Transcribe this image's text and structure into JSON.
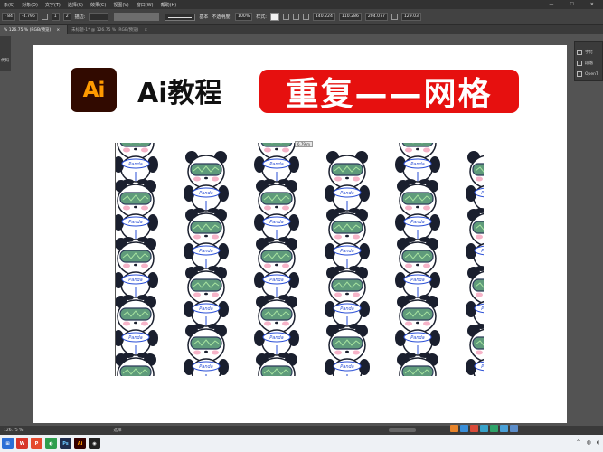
{
  "menubar": {
    "items": [
      "象(S)",
      "对象(O)",
      "文字(T)",
      "选择(S)",
      "效果(C)",
      "视图(V)",
      "窗口(W)",
      "帮助(H)"
    ],
    "wincontrols": [
      "—",
      "☐",
      "✕"
    ]
  },
  "controlbar": {
    "field1": "- 84",
    "field2": "-4.796",
    "field3": "1",
    "field4": "2",
    "label_spacing": "描边:",
    "stroke_style": "基本",
    "label_opacity": "不透明度:",
    "opacity": "100%",
    "label_style": "样式:",
    "x": "140.224",
    "y": "110.286",
    "w": "204.077",
    "h": "129.03",
    "unit": "m"
  },
  "tabs": [
    {
      "label": "% 126.75 % (RGB/预览)",
      "close": "×",
      "active": true
    },
    {
      "label": "未标题-1* @ 126.75 % (RGB/预览)",
      "close": "×",
      "active": false
    }
  ],
  "lefttools": {
    "label": "代码"
  },
  "rightpanel": {
    "items": [
      {
        "icon": "character-icon",
        "label": "字符"
      },
      {
        "icon": "paragraph-icon",
        "label": "段落"
      },
      {
        "icon": "opentype-icon",
        "label": "OpenT"
      }
    ]
  },
  "artboard": {
    "logo_text": "Ai",
    "title": "Ai教程",
    "banner": "重复——网格",
    "tooltip": "6.79 m",
    "panda_label": "Panda"
  },
  "statusbar": {
    "zoom": "126.75 %",
    "mode": "选择"
  },
  "colors": {
    "banner_red": "#e6100f",
    "logo_bg": "#310a00",
    "logo_orange": "#ff9a00",
    "panda_visor": "#5f9b7b"
  }
}
